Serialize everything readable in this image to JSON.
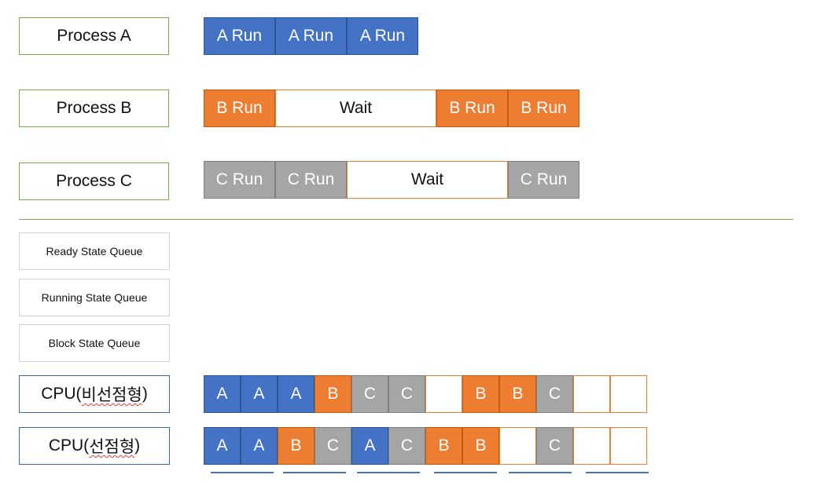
{
  "processes": [
    {
      "label": "Process A",
      "segments": [
        {
          "type": "A",
          "text": "A Run",
          "w": 91
        },
        {
          "type": "A",
          "text": "A Run",
          "w": 91
        },
        {
          "type": "A",
          "text": "A Run",
          "w": 91
        }
      ]
    },
    {
      "label": "Process B",
      "segments": [
        {
          "type": "B",
          "text": "B Run",
          "w": 91
        },
        {
          "type": "W",
          "text": "Wait",
          "w": 205
        },
        {
          "type": "B",
          "text": "B Run",
          "w": 91
        },
        {
          "type": "B",
          "text": "B Run",
          "w": 91
        }
      ]
    },
    {
      "label": "Process C",
      "segments": [
        {
          "type": "C",
          "text": "C Run",
          "w": 91
        },
        {
          "type": "C",
          "text": "C Run",
          "w": 91
        },
        {
          "type": "W",
          "text": "Wait",
          "w": 205
        },
        {
          "type": "C",
          "text": "C Run",
          "w": 91
        }
      ]
    }
  ],
  "queues": [
    {
      "label": "Ready State Queue"
    },
    {
      "label": "Running State Queue"
    },
    {
      "label": "Block State Queue"
    }
  ],
  "cpu_rows": [
    {
      "prefix": "CPU(",
      "korean": "비선점형",
      "suffix": ")",
      "cells": [
        "A",
        "A",
        "A",
        "B",
        "C",
        "C",
        "",
        "B",
        "B",
        "C",
        "",
        ""
      ]
    },
    {
      "prefix": "CPU(",
      "korean": "선점형",
      "suffix": ")",
      "cells": [
        "A",
        "A",
        "B",
        "C",
        "A",
        "C",
        "B",
        "B",
        "",
        "C",
        "",
        ""
      ]
    }
  ],
  "colors": {
    "A": "#4472c4",
    "B": "#ed7d31",
    "C": "#a5a5a5",
    "label_border": "#7aab4a",
    "cpu_border": "#3f66b3"
  }
}
